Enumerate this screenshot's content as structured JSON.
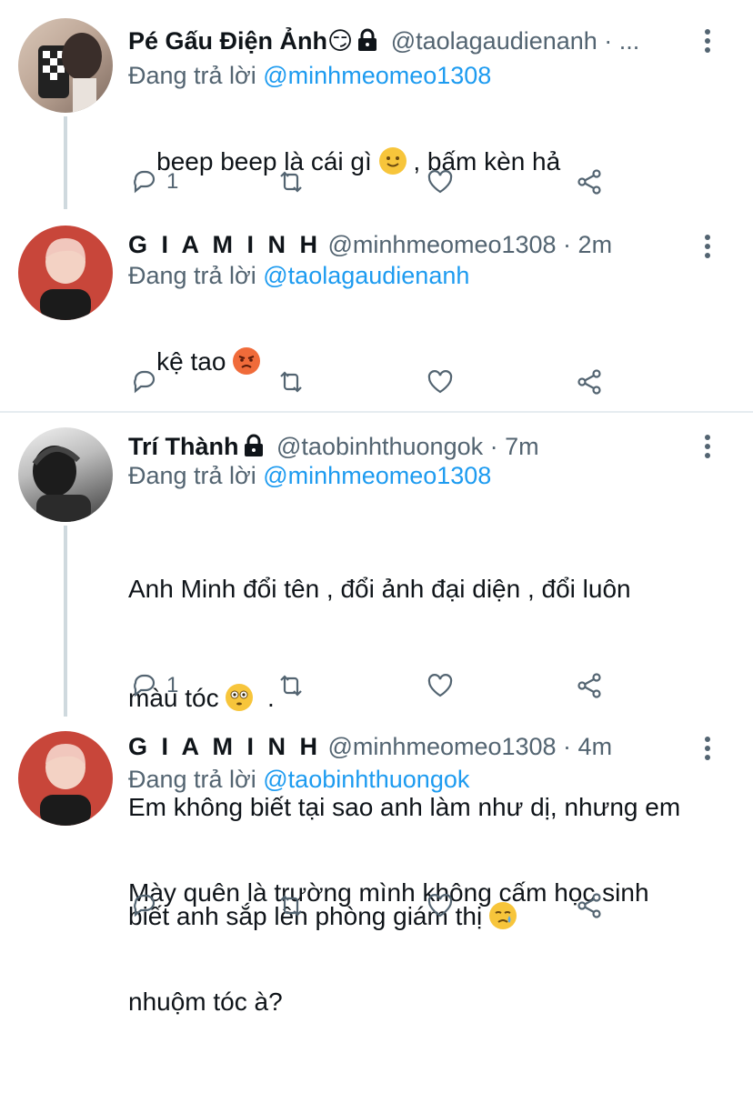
{
  "tweets": [
    {
      "name": "Pé Gấu Điện Ảnh😏",
      "handle": "@taolagaudienanh · ...",
      "replying_prefix": "Đang trả lời ",
      "replying_to": "@minhmeomeo1308",
      "text_before_emoji": "beep beep là cái gì ",
      "text_after_emoji": " , bấm kèn hả",
      "reply_count": "1"
    },
    {
      "name": "G I A M I N H",
      "handle": "@minhmeomeo1308 · 2m",
      "replying_prefix": "Đang trả lời ",
      "replying_to": "@taolagaudienanh",
      "text_before_emoji": "kệ tao ",
      "reply_count": ""
    },
    {
      "name": "Trí Thành",
      "handle": "@taobinhthuongok · 7m",
      "replying_prefix": "Đang trả lời ",
      "replying_to": "@minhmeomeo1308",
      "line1": "Anh Minh đổi tên , đổi ảnh đại diện , đổi luôn",
      "line2_before_emoji": "màu tóc ",
      "line2_after_emoji": "  .",
      "line3": "Em không biết tại sao anh làm như dị, nhưng em",
      "line4_before_emoji": "biết anh sắp lên phòng giám thị ",
      "reply_count": "1"
    },
    {
      "name": "G I A M I N H",
      "handle": "@minhmeomeo1308 · 4m",
      "replying_prefix": "Đang trả lời ",
      "replying_to": "@taobinhthuongok",
      "line1": "Mày quên là trường mình không cấm học sinh",
      "line2": "nhuộm tóc à?",
      "reply_count": ""
    }
  ],
  "icons": {
    "reply": "reply-icon",
    "retweet": "retweet-icon",
    "like": "heart-icon",
    "share": "share-icon",
    "more": "more-icon",
    "lock": "lock-icon"
  },
  "colors": {
    "mention": "#1d9bf0",
    "secondary": "#536471",
    "thread_line": "#cfd9de"
  }
}
